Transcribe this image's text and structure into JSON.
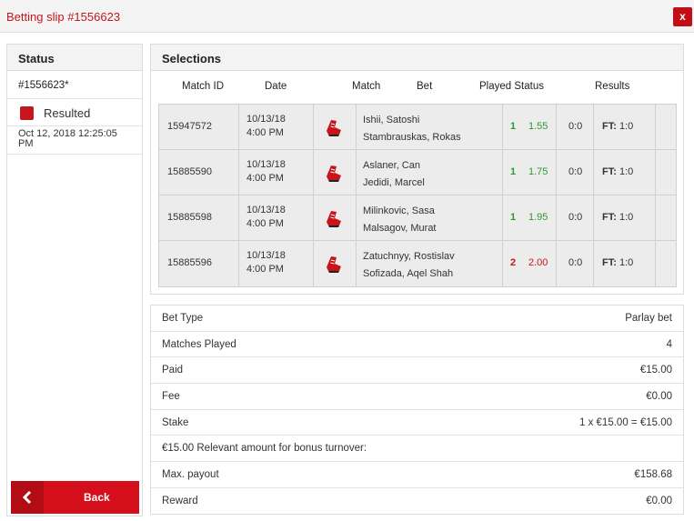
{
  "header": {
    "title": "Betting slip #1556623",
    "close_glyph": "x"
  },
  "status_panel": {
    "heading": "Status",
    "slip_id": "#1556623*",
    "status_label": "Resulted",
    "status_color": "#c4161c",
    "date_line1": "Oct 12, 2018 12:25:05",
    "date_line2": "PM",
    "back_label": "Back",
    "back_icon": "chevron-left-icon"
  },
  "selections": {
    "heading": "Selections",
    "columns": {
      "match_id": "Match ID",
      "date": "Date",
      "match": "Match",
      "bet": "Bet",
      "played_status": "Played Status",
      "results": "Results"
    },
    "sport_icon": "football-boot-icon",
    "rows": [
      {
        "match_id": "15947572",
        "date_line1": "10/13/18",
        "date_line2": "4:00 PM",
        "team1": "Ishii, Satoshi",
        "team2": "Stambrauskas, Rokas",
        "pick": "1",
        "odds": "1.55",
        "outcome": "win",
        "played": "0:0",
        "result_label": "FT:",
        "result_value": "1:0"
      },
      {
        "match_id": "15885590",
        "date_line1": "10/13/18",
        "date_line2": "4:00 PM",
        "team1": "Aslaner, Can",
        "team2": "Jedidi, Marcel",
        "pick": "1",
        "odds": "1.75",
        "outcome": "win",
        "played": "0:0",
        "result_label": "FT:",
        "result_value": "1:0"
      },
      {
        "match_id": "15885598",
        "date_line1": "10/13/18",
        "date_line2": "4:00 PM",
        "team1": "Milinkovic, Sasa",
        "team2": "Malsagov, Murat",
        "pick": "1",
        "odds": "1.95",
        "outcome": "win",
        "played": "0:0",
        "result_label": "FT:",
        "result_value": "1:0"
      },
      {
        "match_id": "15885596",
        "date_line1": "10/13/18",
        "date_line2": "4:00 PM",
        "team1": "Zatuchnyy, Rostislav",
        "team2": "Sofizada, Aqel Shah",
        "pick": "2",
        "odds": "2.00",
        "outcome": "loss",
        "played": "0:0",
        "result_label": "FT:",
        "result_value": "1:0"
      }
    ]
  },
  "summary": {
    "bet_type_label": "Bet Type",
    "bet_type_value": "Parlay bet",
    "matches_played_label": "Matches Played",
    "matches_played_value": "4",
    "paid_label": "Paid",
    "paid_value": "€15.00",
    "fee_label": "Fee",
    "fee_value": "€0.00",
    "stake_label": "Stake",
    "stake_value": "1 x €15.00 = €15.00",
    "bonus_text": "€15.00 Relevant amount for bonus turnover:",
    "max_payout_label": "Max. payout",
    "max_payout_value": "€158.68",
    "reward_label": "Reward",
    "reward_value": "€0.00"
  }
}
